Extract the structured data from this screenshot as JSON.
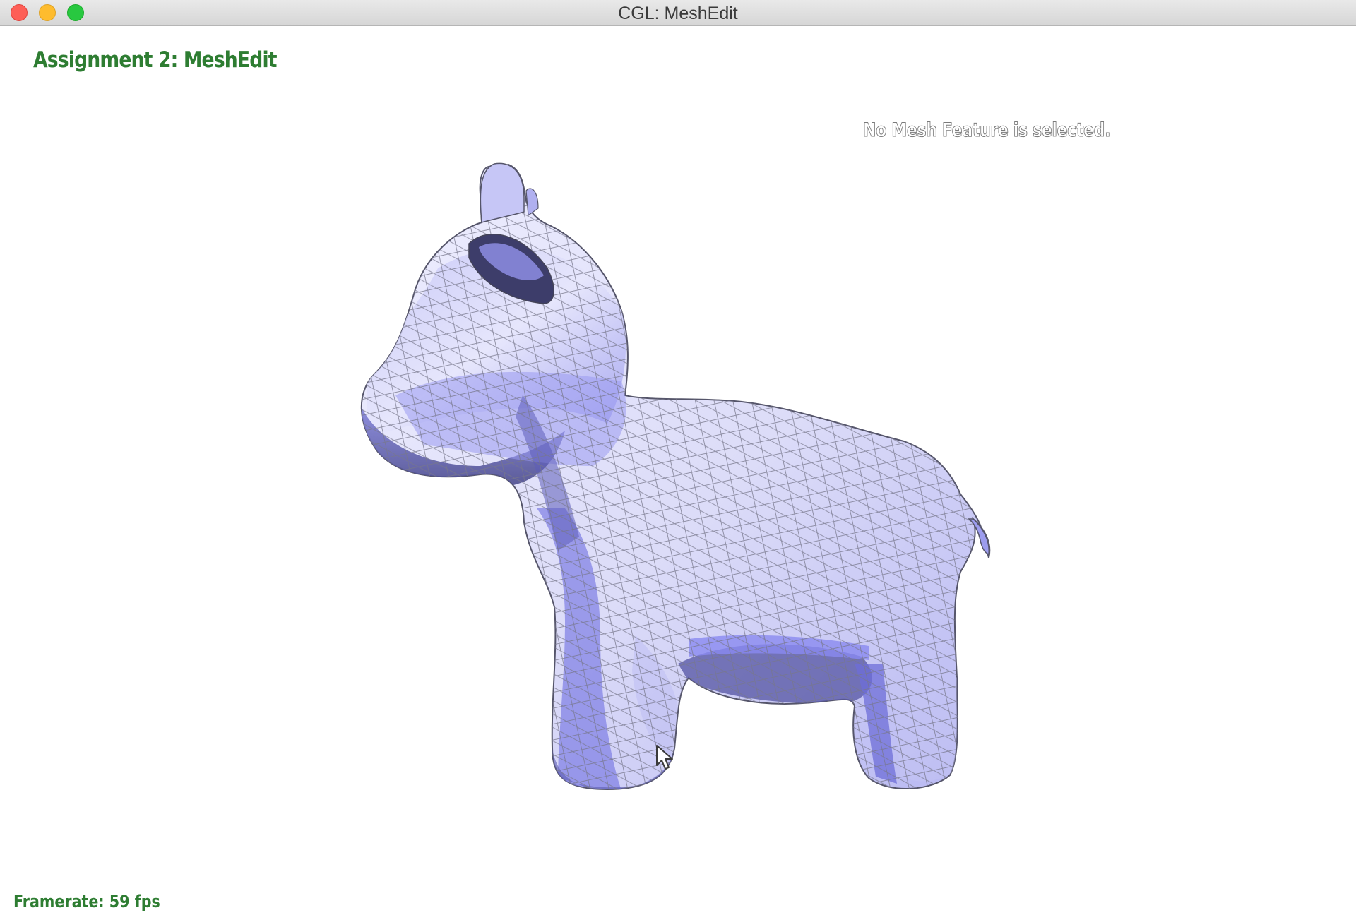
{
  "window": {
    "title": "CGL: MeshEdit"
  },
  "overlay": {
    "heading": "Assignment 2: MeshEdit",
    "selection_status": "No Mesh Feature is selected.",
    "framerate": "Framerate: 59 fps"
  },
  "colors": {
    "heading_green": "#2e7d32",
    "mesh_base": "#8c8cf0",
    "mesh_highlight": "#f2f2ff",
    "mesh_wire": "#6f6f7a"
  },
  "icons": [
    "close-button-icon",
    "minimize-button-icon",
    "zoom-button-icon",
    "mouse-pointer-icon"
  ]
}
